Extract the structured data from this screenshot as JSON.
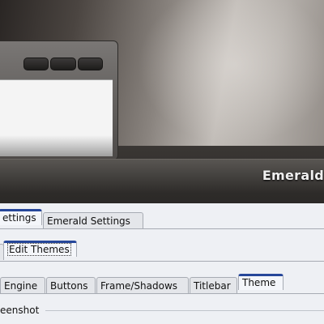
{
  "preview": {
    "brand_text": "Emerald"
  },
  "main_tabs": [
    "ettings",
    "Emerald Settings"
  ],
  "sub_tabs": [
    "Edit Themes"
  ],
  "editor_tabs": [
    "Engine",
    "Buttons",
    "Frame/Shadows",
    "Titlebar",
    "Theme"
  ],
  "group": {
    "label": "eenshot"
  },
  "colors": {
    "tab_accent": "#26479a",
    "panel_bg": "#eef0f4"
  }
}
